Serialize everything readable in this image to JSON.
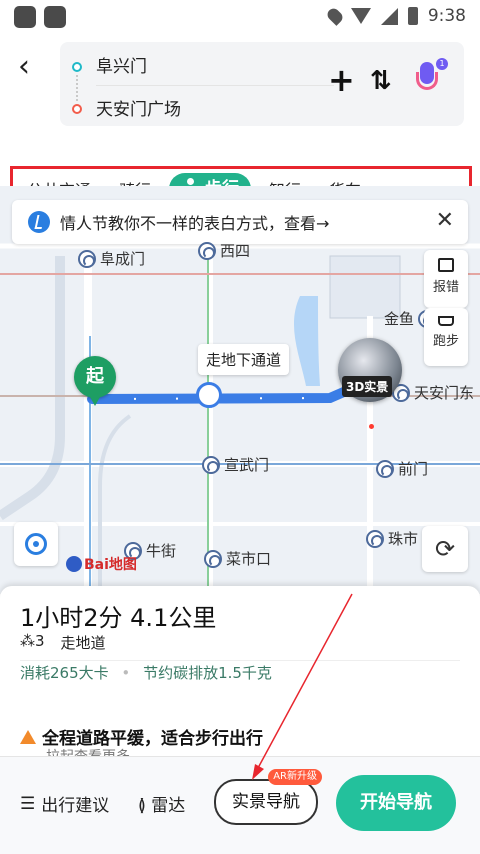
{
  "status_bar": {
    "time": "9:38"
  },
  "header": {
    "from": "阜兴门",
    "to": "天安门广场",
    "back_icon": "chevron-left-icon",
    "add_icon": "plus-icon",
    "swap_icon": "swap-icon",
    "mic_icon": "mic-icon",
    "mic_badge": "1"
  },
  "tabs": [
    {
      "label": "公共交通",
      "active": false
    },
    {
      "label": "骑行",
      "active": false
    },
    {
      "label": "步行",
      "active": true
    },
    {
      "label": "智行",
      "active": false
    },
    {
      "label": "货车",
      "active": false
    }
  ],
  "map": {
    "banner_text": "情人节教你不一样的表白方式，查看→",
    "labels": {
      "fuchengmen": "阜成门",
      "xisi": "西四",
      "jinyu": "金鱼",
      "tiananmen_east": "天安门东",
      "xuanwumen": "宣武门",
      "qianmen": "前门",
      "niujie": "牛街",
      "caishikou": "菜市口",
      "zhushi": "珠市"
    },
    "report_label": "报错",
    "run_label": "跑步",
    "start_pin": "起",
    "tunnel_tip": "走地下通道",
    "view3d_label": "3D实景",
    "logo_text": "Bai地图"
  },
  "summary": {
    "duration_distance": "1小时2分  4.1公里",
    "lights": "3",
    "underpass": "走地道",
    "calories": "消耗265大卡",
    "carbon": "节约碳排放1.5千克",
    "tip_title": "全程道路平缓，适合步行出行",
    "tip_more": "拉起查看更多"
  },
  "bottom_bar": {
    "advice": "出行建议",
    "radar": "雷达",
    "live_nav": "实景导航",
    "ar_badge": "AR新升级",
    "start_nav": "开始导航"
  },
  "colors": {
    "accent_green": "#23c19c",
    "route_blue": "#3b7de6",
    "highlight_red": "#e8262e"
  }
}
